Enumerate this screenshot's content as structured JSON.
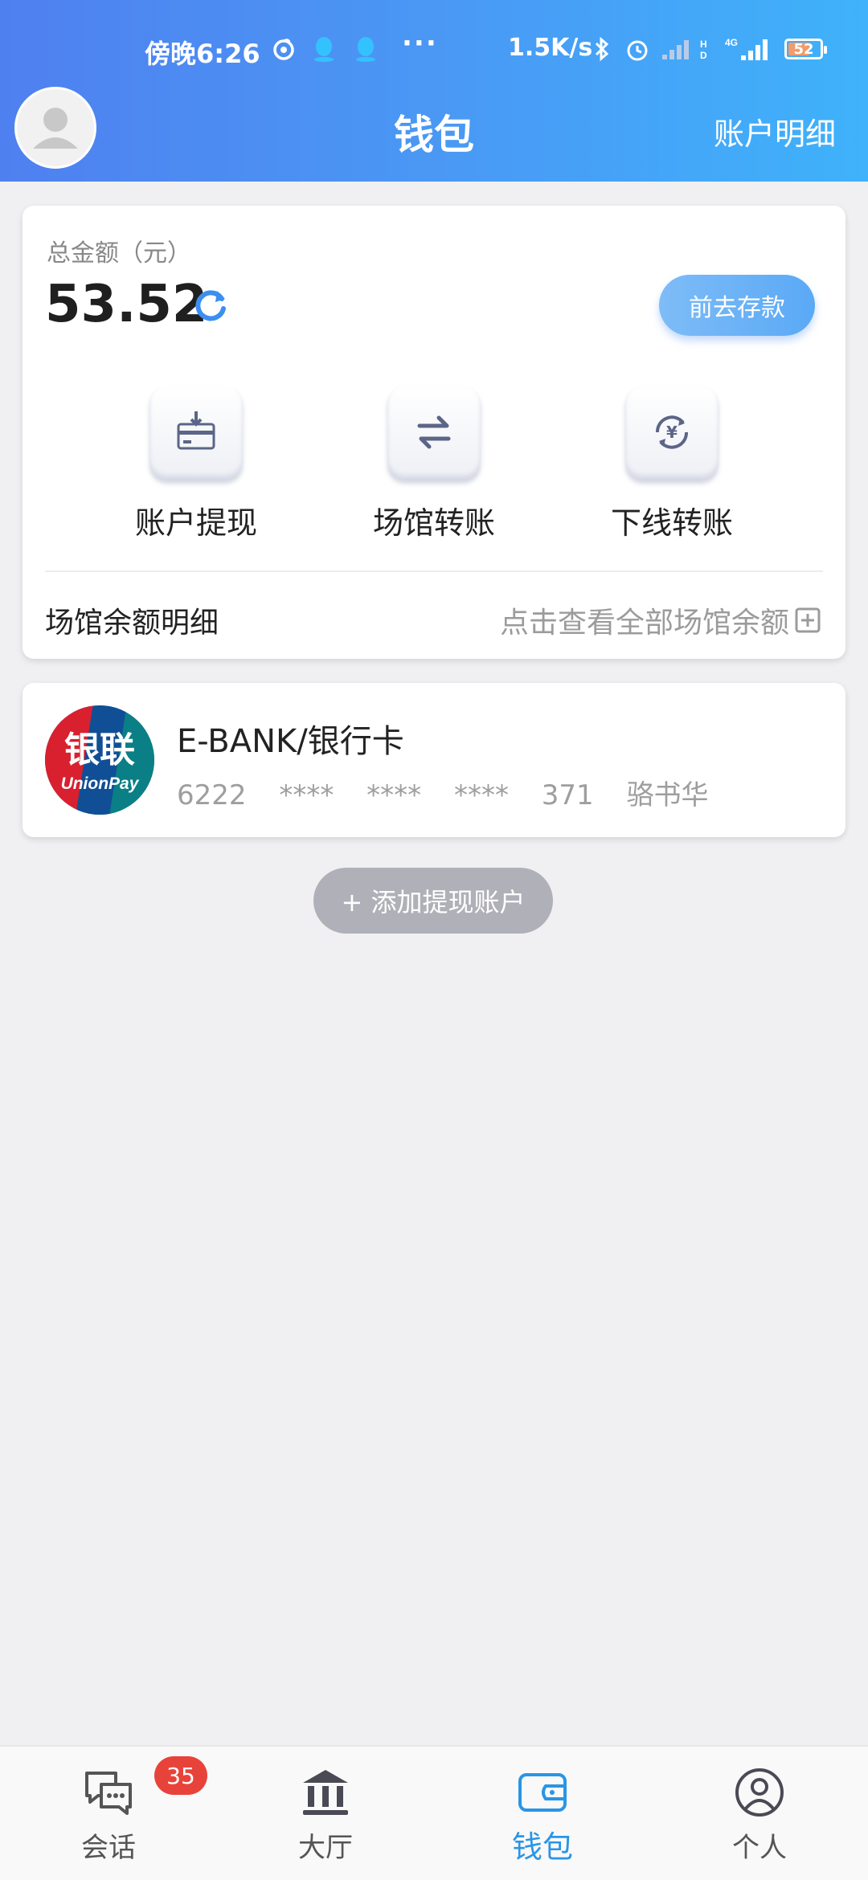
{
  "status_bar": {
    "time": "傍晚6:26",
    "dots": "···",
    "network_speed": "1.5K/s",
    "battery_level": "52"
  },
  "header": {
    "title": "钱包",
    "account_details_link": "账户明细"
  },
  "wallet": {
    "total_label": "总金额（元）",
    "total_amount": "53.52",
    "deposit_button": "前去存款",
    "actions": [
      {
        "label": "账户提现",
        "icon": "card-withdraw-icon"
      },
      {
        "label": "场馆转账",
        "icon": "transfer-arrows-icon"
      },
      {
        "label": "下线转账",
        "icon": "yuan-transfer-icon"
      }
    ],
    "venue_balance_label": "场馆余额明细",
    "venue_balance_link": "点击查看全部场馆余额"
  },
  "bank_account": {
    "name": "E-BANK/银行卡",
    "card_number": "6222 **** **** **** 371 骆书华",
    "logo_text_cn": "银联",
    "logo_text_en": "UnionPay"
  },
  "add_account_button": "+ 添加提现账户",
  "bottom_nav": {
    "items": [
      {
        "label": "会话",
        "badge": "35",
        "icon": "chat-icon"
      },
      {
        "label": "大厅",
        "icon": "hall-icon"
      },
      {
        "label": "钱包",
        "icon": "wallet-icon",
        "active": true
      },
      {
        "label": "个人",
        "icon": "profile-icon"
      }
    ]
  },
  "colors": {
    "header_gradient_start": "#4f80f0",
    "header_gradient_end": "#3fb2fb",
    "accent_blue": "#2a95e6",
    "badge_red": "#e8433a",
    "page_background": "#f0f0f2"
  }
}
